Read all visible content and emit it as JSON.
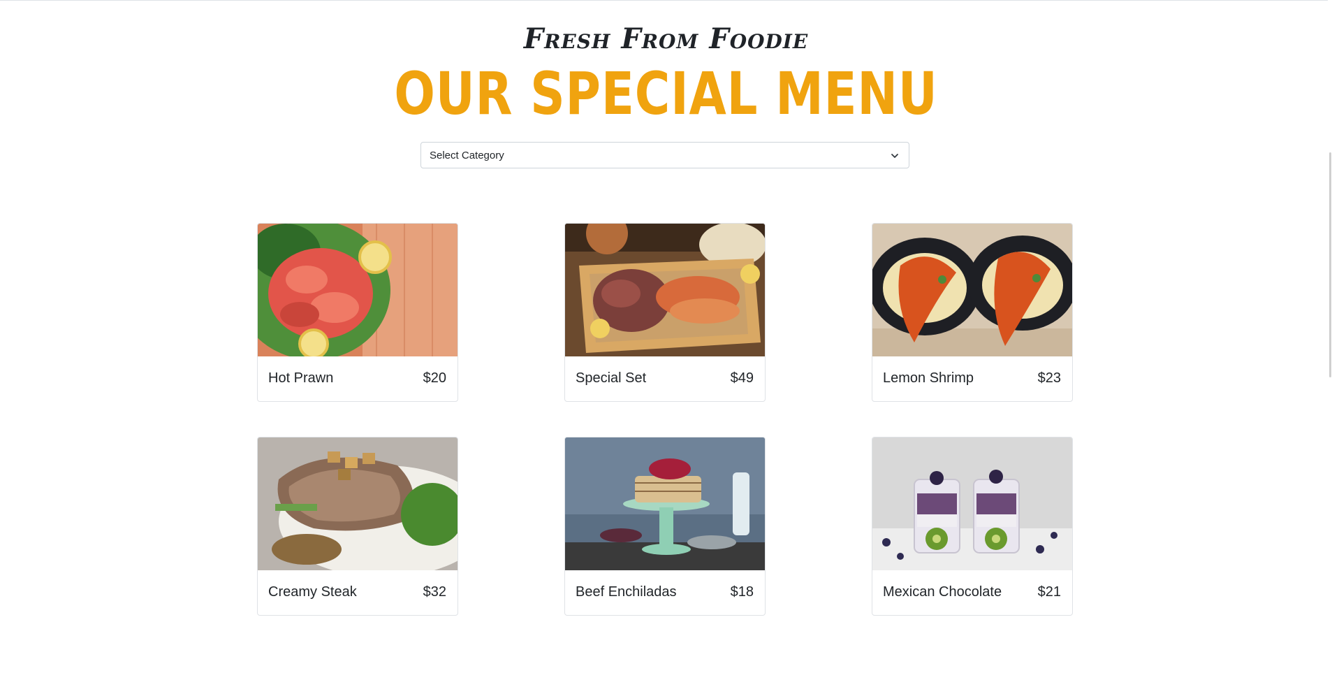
{
  "header": {
    "tagline": "Fresh From Foodie",
    "title": "OUR SPECIAL MENU"
  },
  "category_select": {
    "value": "Select Category",
    "icon": "chevron-down-icon"
  },
  "menu_items": [
    {
      "name": "Hot Prawn",
      "price": "$20",
      "image": "prawns-with-lemon-on-wooden-board"
    },
    {
      "name": "Special Set",
      "price": "$49",
      "image": "grilled-octopus-and-seafood-platter"
    },
    {
      "name": "Lemon Shrimp",
      "price": "$23",
      "image": "lobster-tails-in-cast-iron-pots"
    },
    {
      "name": "Creamy Steak",
      "price": "$32",
      "image": "grilled-pork-chop-with-broccoli"
    },
    {
      "name": "Beef Enchiladas",
      "price": "$18",
      "image": "crepe-cake-with-berries-on-stand"
    },
    {
      "name": "Mexican Chocolate",
      "price": "$21",
      "image": "chia-pudding-with-kiwi-and-blueberries"
    }
  ],
  "colors": {
    "title_accent": "#f0a30f",
    "text": "#212529",
    "card_border": "#dfe2e6"
  }
}
